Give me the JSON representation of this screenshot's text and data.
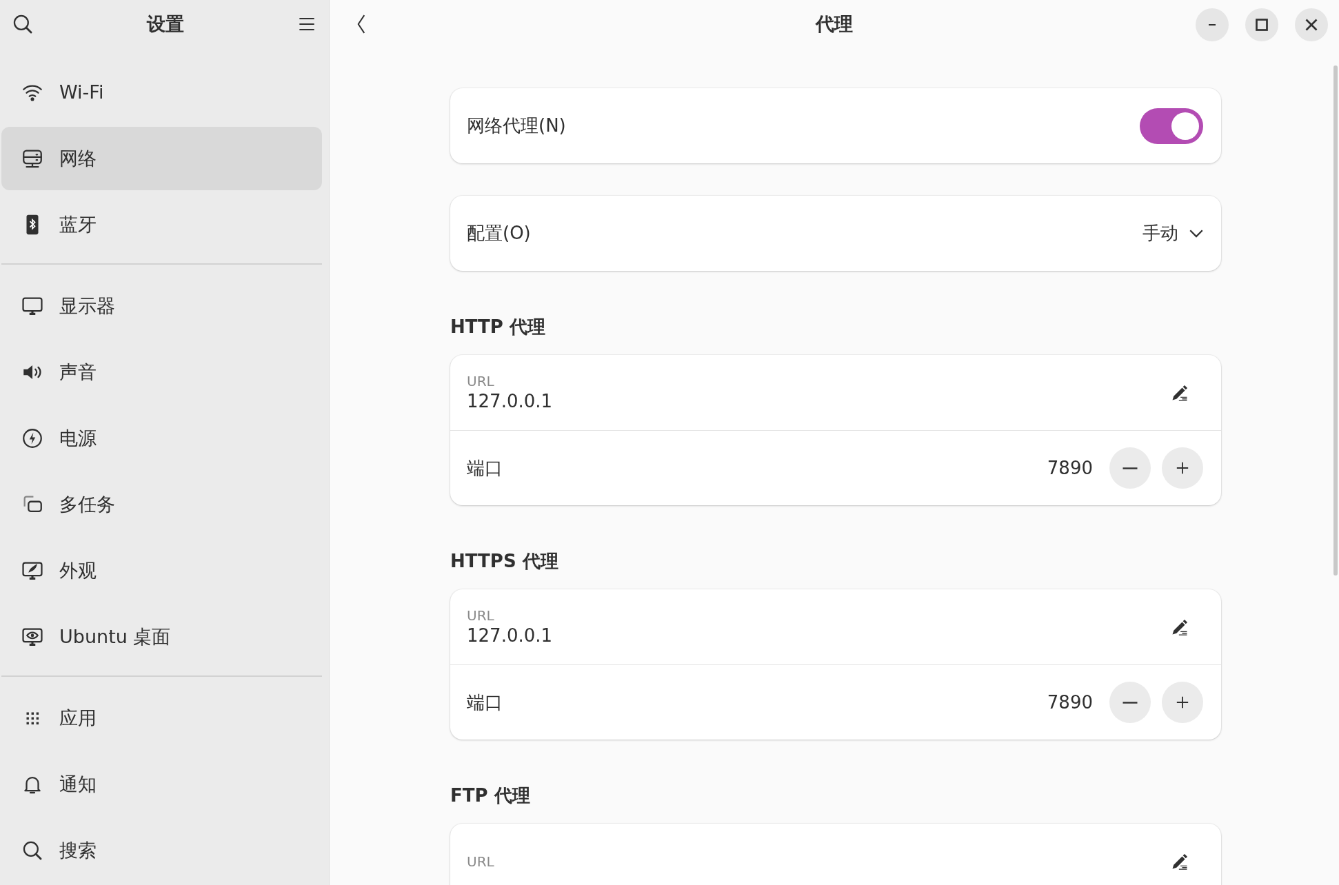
{
  "sidebar": {
    "title": "设置",
    "sections": [
      {
        "items": [
          {
            "label": "Wi-Fi",
            "selected": false
          },
          {
            "label": "网络",
            "selected": true
          },
          {
            "label": "蓝牙",
            "selected": false
          }
        ]
      },
      {
        "items": [
          {
            "label": "显示器",
            "selected": false
          },
          {
            "label": "声音",
            "selected": false
          },
          {
            "label": "电源",
            "selected": false
          },
          {
            "label": "多任务",
            "selected": false
          },
          {
            "label": "外观",
            "selected": false
          },
          {
            "label": "Ubuntu 桌面",
            "selected": false
          }
        ]
      },
      {
        "items": [
          {
            "label": "应用",
            "selected": false
          },
          {
            "label": "通知",
            "selected": false
          },
          {
            "label": "搜索",
            "selected": false
          }
        ]
      }
    ]
  },
  "header": {
    "title": "代理"
  },
  "proxy_switch": {
    "label": "网络代理(N)",
    "on": true
  },
  "configuration": {
    "label": "配置(O)",
    "value": "手动"
  },
  "sections": [
    {
      "heading": "HTTP 代理",
      "url_label": "URL",
      "url": "127.0.0.1",
      "port_label": "端口",
      "port": "7890"
    },
    {
      "heading": "HTTPS 代理",
      "url_label": "URL",
      "url": "127.0.0.1",
      "port_label": "端口",
      "port": "7890"
    },
    {
      "heading": "FTP 代理",
      "url_label": "URL"
    }
  ]
}
